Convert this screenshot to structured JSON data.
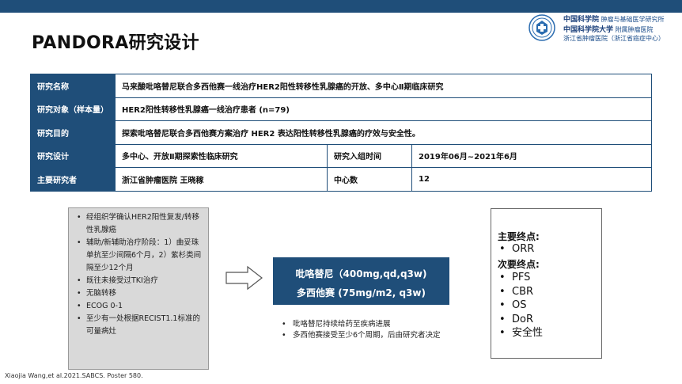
{
  "slide": {
    "title": "PANDORA研究设计",
    "top_bar_color": "#1f4e79"
  },
  "logo": {
    "seal_icon": "hospital-seal-icon",
    "line1_cn": "中国科学院",
    "line1_text": "肿瘤与基础医学研究所",
    "line2_cn": "中国科学院大学",
    "line2_text": "附属肿瘤医院",
    "line3_text": "浙江省肿瘤医院（浙江省癌症中心）"
  },
  "info_table": {
    "rows": [
      {
        "label": "研究名称",
        "value": "马来酸吡咯替尼联合多西他赛一线治疗HER2阳性转移性乳腺癌的开放、多中心Ⅱ期临床研究"
      },
      {
        "label": "研究对象（样本量）",
        "value": "HER2阳性转移性乳腺癌一线治疗患者   (n=79)"
      },
      {
        "label": "研究目的",
        "value": "探索吡咯替尼联合多西他赛方案治疗 HER2 表达阳性转移性乳腺癌的疗效与安全性。"
      },
      {
        "label": "研究设计",
        "value": "多中心、开放Ⅱ期探索性临床研究",
        "label2": "研究入组时间",
        "value2": "2019年06月~2021年6月"
      },
      {
        "label": "主要研究者",
        "value": "浙江省肿瘤医院  王晓稼",
        "label2": "中心数",
        "value2": "12"
      }
    ],
    "header_color": "#1f4e79"
  },
  "inclusion_criteria": {
    "items": [
      "经组织学确认HER2阳性复发/转移性乳腺癌",
      "辅助/新辅助治疗阶段：1）曲妥珠单抗至少间隔6个月，2）紫杉类间隔至少12个月",
      "既往未接受过TKI治疗",
      "无脑转移",
      "ECOG 0-1",
      "至少有一处根据RECIST1.1标准的可量病灶"
    ],
    "background_color": "#d9d9d9"
  },
  "arrow_icon": "right-arrow-icon",
  "treatment": {
    "line1": "吡咯替尼（400mg,qd,q3w)",
    "line2": "多西他赛  (75mg/m2, q3w)",
    "notes": [
      "吡咯替尼持续给药至疾病进展",
      "多西他赛接受至少6个周期，后由研究者决定"
    ]
  },
  "endpoints": {
    "primary_heading": "主要终点:",
    "primary": [
      "ORR"
    ],
    "secondary_heading": "次要终点:",
    "secondary": [
      "PFS",
      "CBR",
      "OS",
      "DoR",
      "安全性"
    ]
  },
  "footnote": "Xiaojia Wang,et al.2021.SABCS. Poster 580."
}
